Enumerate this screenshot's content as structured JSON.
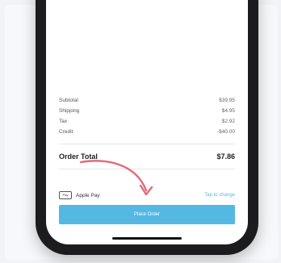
{
  "summary": {
    "rows": [
      {
        "label": "Subtotal",
        "value": "$39.95"
      },
      {
        "label": "Shipping",
        "value": "$4.95"
      },
      {
        "label": "Tax",
        "value": "$2.92"
      },
      {
        "label": "Credit",
        "value": "-$40.00"
      }
    ],
    "total_label": "Order Total",
    "total_value": "$7.86"
  },
  "payment": {
    "badge": "Pay",
    "method": "Apple Pay",
    "change_label": "Tap to change"
  },
  "actions": {
    "place_order_label": "Place Order"
  },
  "colors": {
    "accent": "#54b8e3",
    "annotation_arrow": "#e4687c"
  }
}
